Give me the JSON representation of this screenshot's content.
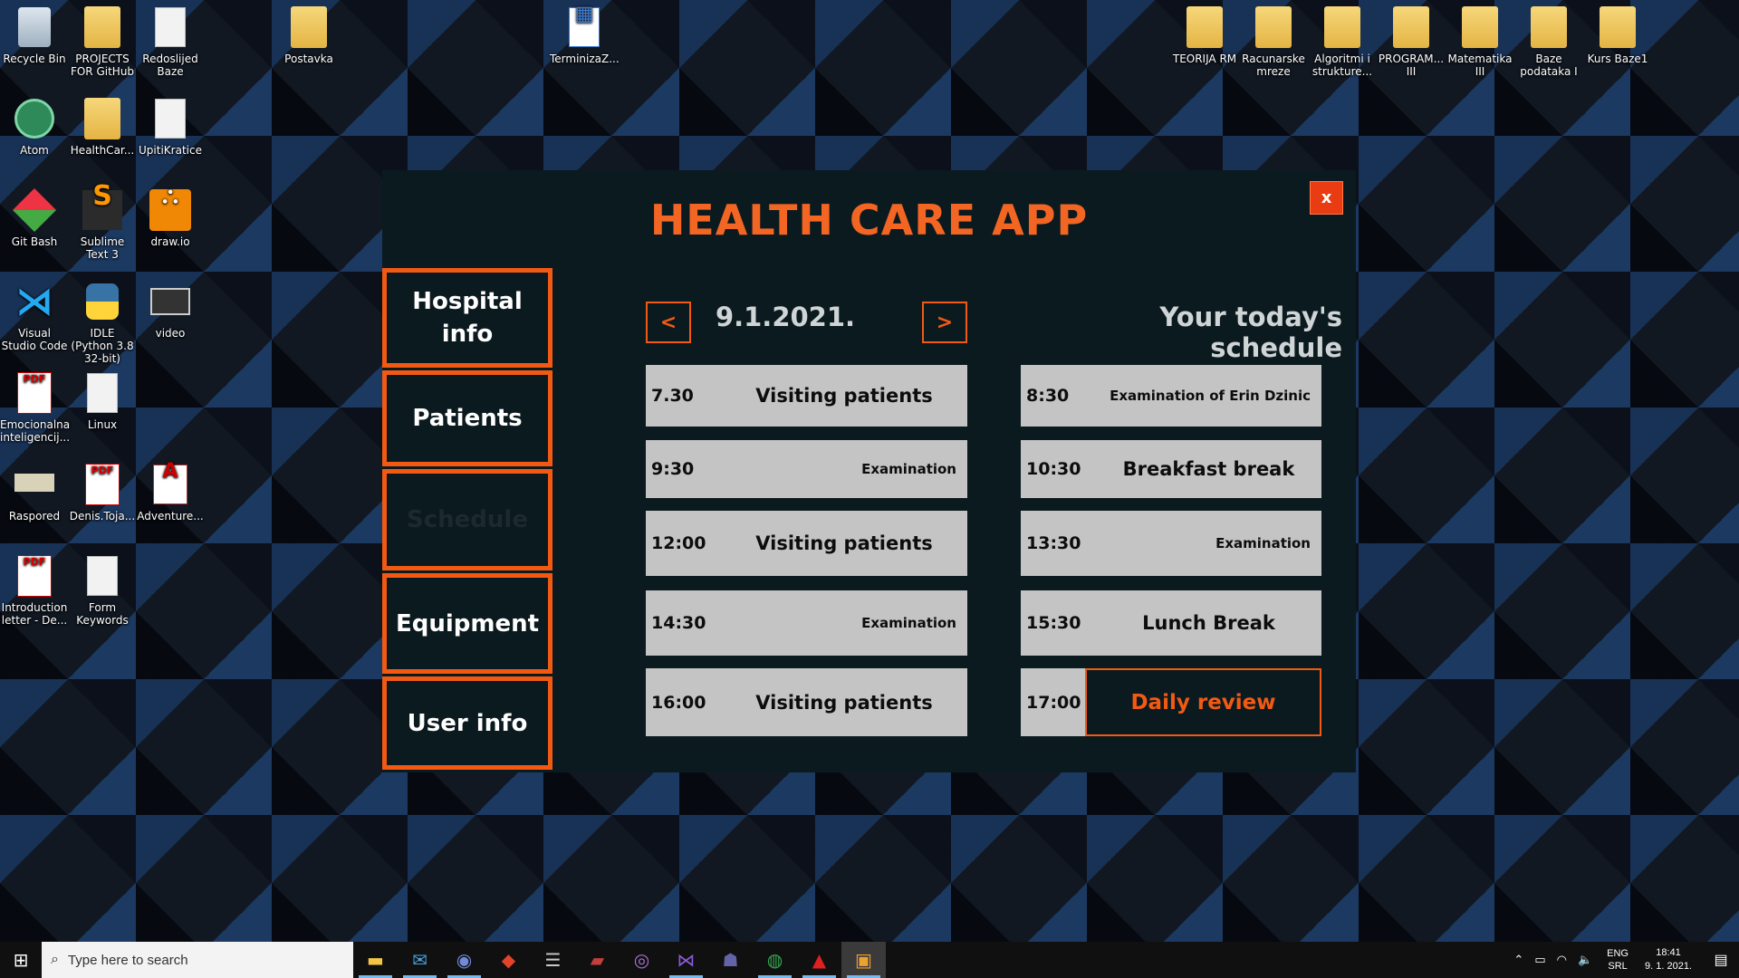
{
  "desktop": {
    "icons": [
      {
        "label": "Recycle Bin",
        "icon": "recycle-bin-icon"
      },
      {
        "label": "PROJECTS FOR GitHub",
        "icon": "folder-icon"
      },
      {
        "label": "Redoslijed Baze",
        "icon": "document-icon"
      },
      {
        "label": "Postavka",
        "icon": "folder-icon"
      },
      {
        "label": "TerminizaZ...",
        "icon": "calculator-icon"
      },
      {
        "label": "Atom",
        "icon": "atom-icon"
      },
      {
        "label": "HealthCar...",
        "icon": "folder-icon"
      },
      {
        "label": "UpitiKratice",
        "icon": "document-icon"
      },
      {
        "label": "Git Bash",
        "icon": "git-icon"
      },
      {
        "label": "Sublime Text 3",
        "icon": "sublime-icon"
      },
      {
        "label": "draw.io",
        "icon": "drawio-icon"
      },
      {
        "label": "Visual Studio Code",
        "icon": "vscode-icon"
      },
      {
        "label": "IDLE (Python 3.8 32-bit)",
        "icon": "python-icon"
      },
      {
        "label": "video",
        "icon": "video-icon"
      },
      {
        "label": "Emocionalna inteligencij...",
        "icon": "pdf-icon"
      },
      {
        "label": "Linux",
        "icon": "document-icon"
      },
      {
        "label": "Raspored",
        "icon": "image-icon"
      },
      {
        "label": "Denis.Toja...",
        "icon": "pdf-icon"
      },
      {
        "label": "Adventure...",
        "icon": "access-icon"
      },
      {
        "label": "Introduction letter - De...",
        "icon": "pdf-icon"
      },
      {
        "label": "Form Keywords",
        "icon": "document-icon"
      },
      {
        "label": "TEORIJA RM",
        "icon": "folder-icon"
      },
      {
        "label": "Racunarske mreze",
        "icon": "folder-icon"
      },
      {
        "label": "Algoritmi i strukture...",
        "icon": "folder-icon"
      },
      {
        "label": "PROGRAM... III",
        "icon": "folder-icon"
      },
      {
        "label": "Matematika III",
        "icon": "folder-icon"
      },
      {
        "label": "Baze podataka I",
        "icon": "folder-icon"
      },
      {
        "label": "Kurs Baze1",
        "icon": "folder-icon"
      }
    ]
  },
  "app": {
    "title": "HEALTH CARE APP",
    "close_label": "x",
    "nav": [
      {
        "label": "Hospital info",
        "active": false
      },
      {
        "label": "Patients",
        "active": false
      },
      {
        "label": "Schedule",
        "active": true
      },
      {
        "label": "Equipment",
        "active": false
      },
      {
        "label": "User info",
        "active": false
      }
    ],
    "prev_label": "<",
    "next_label": ">",
    "date": "9.1.2021.",
    "schedule_heading": "Your today's schedule",
    "left_column": [
      {
        "time": "7.30",
        "label": "Visiting patients",
        "size": "big"
      },
      {
        "time": "9:30",
        "label": "Examination",
        "size": "small"
      },
      {
        "time": "12:00",
        "label": "Visiting patients",
        "size": "big"
      },
      {
        "time": "14:30",
        "label": "Examination",
        "size": "small"
      },
      {
        "time": "16:00",
        "label": "Visiting patients",
        "size": "big"
      }
    ],
    "right_column": [
      {
        "time": "8:30",
        "label": "Examination of Erin Dzinic",
        "size": "small"
      },
      {
        "time": "10:30",
        "label": "Breakfast break",
        "size": "big"
      },
      {
        "time": "13:30",
        "label": "Examination",
        "size": "small"
      },
      {
        "time": "15:30",
        "label": "Lunch Break",
        "size": "big"
      },
      {
        "time": "17:00",
        "label": "Daily review",
        "size": "review"
      }
    ],
    "colors": {
      "accent": "#f25a14",
      "background": "#0b1a1f",
      "slot": "#c4c4c4"
    }
  },
  "taskbar": {
    "search_placeholder": "Type here to search",
    "apps": [
      "file-explorer-icon",
      "mail-icon",
      "discord-icon",
      "git-icon",
      "database-icon",
      "access-icon",
      "teams-purple-icon",
      "visual-studio-icon",
      "teams-icon",
      "chrome-icon",
      "acrobat-icon",
      "winforms-app-icon"
    ],
    "lang_top": "ENG",
    "lang_bottom": "SRL",
    "time": "18:41",
    "date": "9. 1. 2021."
  }
}
